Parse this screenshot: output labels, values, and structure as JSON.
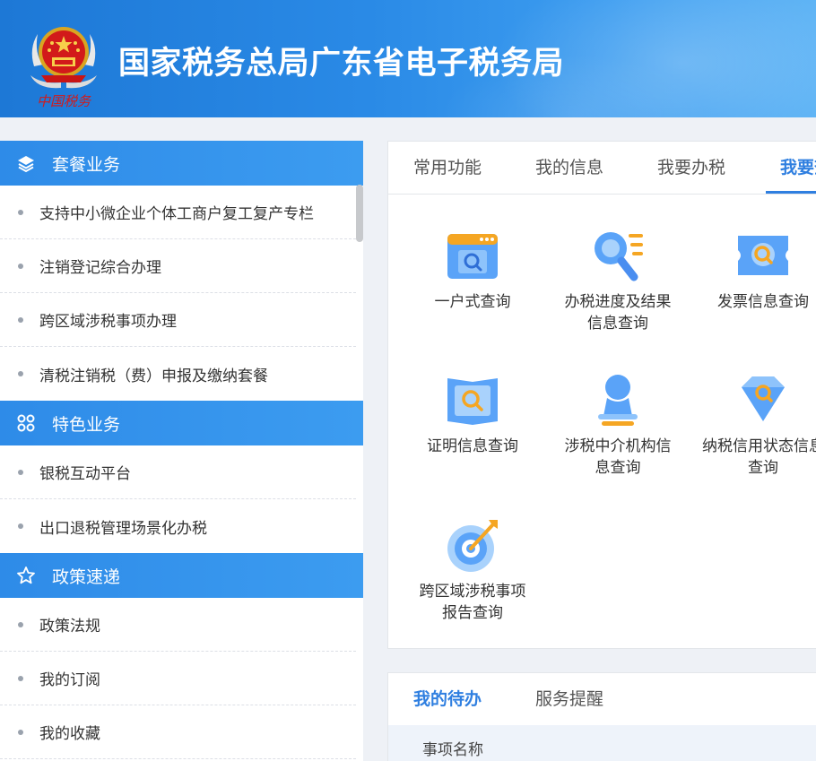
{
  "header": {
    "title": "国家税务总局广东省电子税务局",
    "emblem_text": "中国税务"
  },
  "sidebar": {
    "sections": [
      {
        "title": "套餐业务",
        "icon": "layers-icon",
        "items": [
          "支持中小微企业个体工商户复工复产专栏",
          "注销登记综合办理",
          "跨区域涉税事项办理",
          "清税注销税（费）申报及缴纳套餐"
        ]
      },
      {
        "title": "特色业务",
        "icon": "grid-icon",
        "items": [
          "银税互动平台",
          "出口退税管理场景化办税"
        ]
      },
      {
        "title": "政策速递",
        "icon": "star-icon",
        "items": [
          "政策法规",
          "我的订阅",
          "我的收藏"
        ]
      }
    ]
  },
  "main": {
    "tabs": [
      "常用功能",
      "我的信息",
      "我要办税",
      "我要查询"
    ],
    "active_tab": 3,
    "tiles": [
      {
        "label": "一户式查询",
        "icon": "browser-search-icon"
      },
      {
        "label": "办税进度及结果信息查询",
        "icon": "magnifier-list-icon"
      },
      {
        "label": "发票信息查询",
        "icon": "invoice-search-icon"
      },
      {
        "label": "证明信息查询",
        "icon": "certificate-search-icon"
      },
      {
        "label": "涉税中介机构信息查询",
        "icon": "person-icon"
      },
      {
        "label": "纳税信用状态信息查询",
        "icon": "diamond-search-icon"
      },
      {
        "label": "跨区域涉税事项报告查询",
        "icon": "target-icon"
      }
    ]
  },
  "bottom": {
    "tabs": [
      "我的待办",
      "服务提醒"
    ],
    "column_header": "事项名称"
  },
  "colors": {
    "accent": "#2f7fe0",
    "header_start": "#1d78d6",
    "header_end": "#5db3f5",
    "icon_orange": "#f5a623"
  }
}
